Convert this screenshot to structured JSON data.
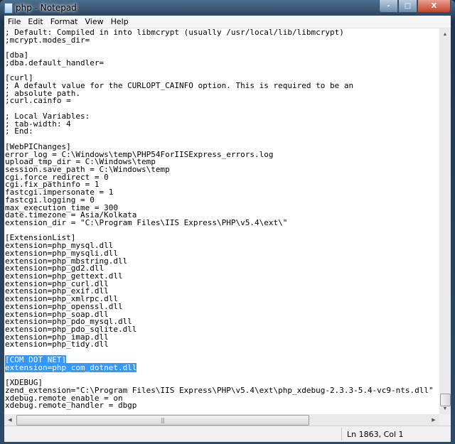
{
  "window": {
    "title": "php - Notepad",
    "minimize": "-",
    "maximize": "□",
    "close": "X"
  },
  "menu": [
    "File",
    "Edit",
    "Format",
    "View",
    "Help"
  ],
  "editor": {
    "lines": [
      "; Default: Compiled in into libmcrypt (usually /usr/local/lib/libmcrypt)",
      ";mcrypt.modes_dir=",
      "",
      "[dba]",
      ";dba.default_handler=",
      "",
      "[curl]",
      "; A default value for the CURLOPT_CAINFO option. This is required to be an",
      "; absolute path.",
      ";curl.cainfo =",
      "",
      "; Local Variables:",
      "; tab-width: 4",
      "; End:",
      "",
      "[WebPIChanges]",
      "error_log = C:\\Windows\\temp\\PHP54ForIISExpress_errors.log",
      "upload_tmp_dir = C:\\Windows\\temp",
      "session.save_path = C:\\Windows\\temp",
      "cgi.force_redirect = 0",
      "cgi.fix_pathinfo = 1",
      "fastcgi.impersonate = 1",
      "fastcgi.logging = 0",
      "max_execution_time = 300",
      "date.timezone = Asia/Kolkata",
      "extension_dir = \"C:\\Program Files\\IIS Express\\PHP\\v5.4\\ext\\\"",
      "",
      "[ExtensionList]",
      "extension=php_mysql.dll",
      "extension=php_mysqli.dll",
      "extension=php_mbstring.dll",
      "extension=php_gd2.dll",
      "extension=php_gettext.dll",
      "extension=php_curl.dll",
      "extension=php_exif.dll",
      "extension=php_xmlrpc.dll",
      "extension=php_openssl.dll",
      "extension=php_soap.dll",
      "extension=php_pdo_mysql.dll",
      "extension=php_pdo_sqlite.dll",
      "extension=php_imap.dll",
      "extension=php_tidy.dll",
      "",
      "[COM_DOT_NET]",
      "extension=php_com_dotnet.dll",
      "",
      "[XDEBUG]",
      "zend_extension=\"C:\\Program Files\\IIS Express\\PHP\\v5.4\\ext\\php_xdebug-2.3.3-5.4-vc9-nts.dll\"",
      "xdebug.remote_enable = on",
      "xdebug.remote_handler = dbgp"
    ],
    "selected_lines": [
      43,
      44
    ],
    "selection_color": "#3399ff"
  },
  "status": {
    "position": "Ln 1863, Col 1"
  }
}
